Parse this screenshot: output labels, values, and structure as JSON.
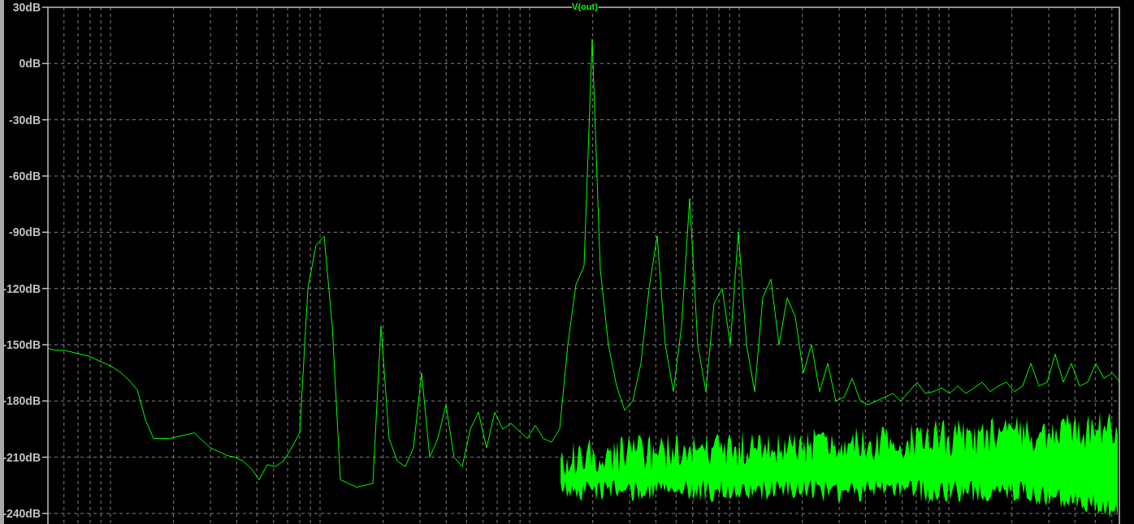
{
  "plot": {
    "chart_data": {
      "type": "line",
      "grid": true,
      "ylim": [
        -240,
        30
      ],
      "yticks": [
        {
          "value": 30,
          "label": "30dB"
        },
        {
          "value": 0,
          "label": "0dB"
        },
        {
          "value": -30,
          "label": "-30dB"
        },
        {
          "value": -60,
          "label": "-60dB"
        },
        {
          "value": -90,
          "label": "-90dB"
        },
        {
          "value": -120,
          "label": "-120dB"
        },
        {
          "value": -150,
          "label": "-150dB"
        },
        {
          "value": -180,
          "label": "-180dB"
        },
        {
          "value": -210,
          "label": "-210dB"
        },
        {
          "value": -240,
          "label": "-240dB"
        }
      ],
      "series": [
        {
          "name": "V(out)",
          "color": "#00ff00",
          "values": [
            -152,
            -153,
            -153,
            -154,
            -155,
            -156,
            -158,
            -160,
            -162,
            -165,
            -169,
            -174,
            -190,
            -200,
            -200,
            -200,
            -199,
            -198,
            -197,
            -201,
            -205,
            -207,
            -209,
            -210,
            -212,
            -216,
            -222,
            -214,
            -215,
            -212,
            -205,
            -197,
            -120,
            -97,
            -92,
            -140,
            -222,
            -224,
            -226,
            -225,
            -224,
            -140,
            -200,
            -212,
            -215,
            -205,
            -165,
            -210,
            -200,
            -182,
            -210,
            -215,
            -195,
            -186,
            -205,
            -186,
            -195,
            -192,
            -196,
            -200,
            -193,
            -200,
            -202,
            -195,
            -150,
            -118,
            -108,
            13,
            -110,
            -150,
            -172,
            -185,
            -180,
            -160,
            -120,
            -92,
            -150,
            -175,
            -140,
            -72,
            -150,
            -175,
            -128,
            -120,
            -150,
            -90,
            -150,
            -175,
            -125,
            -115,
            -150,
            -125,
            -135,
            -165,
            -150,
            -175,
            -160,
            -180,
            -178,
            -168,
            -180,
            -182,
            -180,
            -178,
            -176,
            -180,
            -175,
            -170,
            -176,
            -175,
            -173,
            -176,
            -172,
            -176,
            -173,
            -170,
            -175,
            -172,
            -170,
            -175,
            -172,
            -160,
            -172,
            -170,
            -155,
            -170,
            -160,
            -172,
            -170,
            -160,
            -168,
            -165,
            -170
          ]
        }
      ]
    }
  }
}
